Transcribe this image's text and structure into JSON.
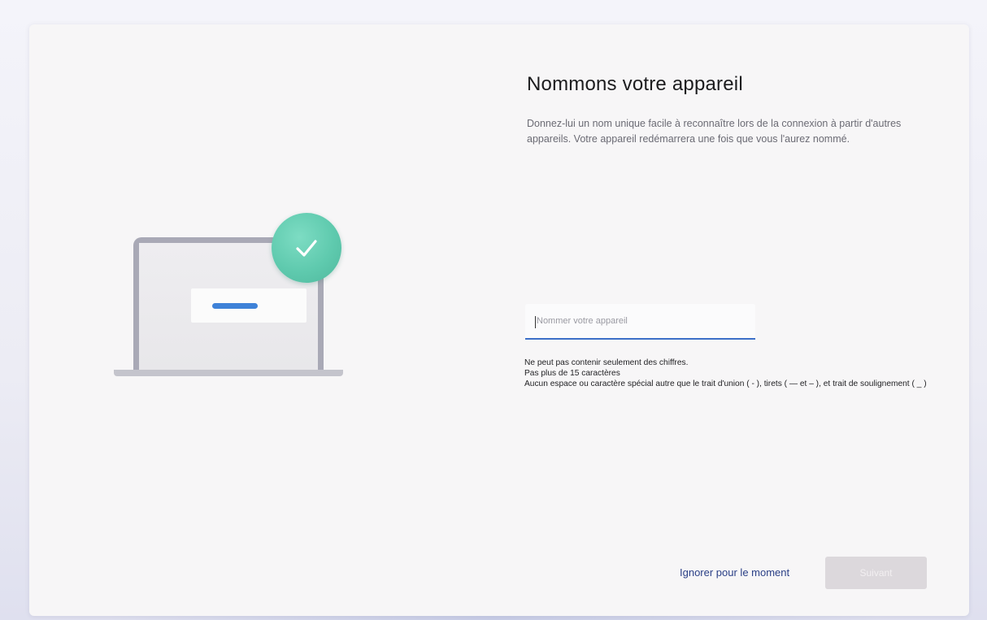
{
  "page": {
    "title": "Nommons votre appareil",
    "description": "Donnez-lui un nom unique facile à reconnaître lors de la connexion à partir d'autres appareils. Votre appareil redémarrera une fois que vous l'aurez nommé."
  },
  "name_field": {
    "value": "",
    "placeholder": "Nommer votre appareil"
  },
  "rules": [
    "Ne peut pas contenir seulement des chiffres.",
    "Pas plus de 15 caractères",
    "Aucun espace ou caractère spécial autre que le trait d'union ( - ), tirets ( — et – ), et trait de soulignement ( _ )"
  ],
  "actions": {
    "skip_label": "Ignorer pour le moment",
    "next_label": "Suivant",
    "next_enabled": false
  },
  "illustration": {
    "icons": [
      "laptop-icon",
      "checkmark-icon"
    ],
    "colors": {
      "check_badge": "#5fcaae",
      "laptop_frame": "#a9a9b6",
      "accent_bar": "#3e82d8"
    }
  },
  "colors": {
    "accent": "#3b6fc8",
    "link": "#2a3f86",
    "button_disabled": "#dcd8dc"
  }
}
